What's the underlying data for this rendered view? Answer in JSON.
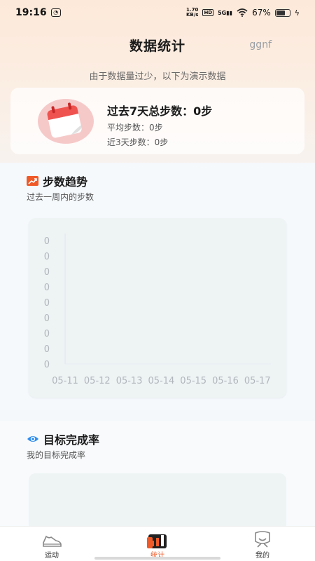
{
  "status_bar": {
    "time": "19:16",
    "net_speed_value": "1.70",
    "net_speed_unit": "KB/s",
    "hd": "HD",
    "signal": "5G",
    "battery": "67%"
  },
  "header": {
    "title": "数据统计",
    "user": "ggnf"
  },
  "notice": "由于数据量过少，以下为演示数据",
  "summary": {
    "total": "过去7天总步数：0步",
    "average": "平均步数：0步",
    "recent3": "近3天步数：0步"
  },
  "trend": {
    "title": "步数趋势",
    "subtitle": "过去一周内的步数"
  },
  "chart_data": {
    "type": "line",
    "x": [
      "05-11",
      "05-12",
      "05-13",
      "05-14",
      "05-15",
      "05-16",
      "05-17"
    ],
    "y_ticks": [
      "0",
      "0",
      "0",
      "0",
      "0",
      "0",
      "0",
      "0",
      "0"
    ],
    "series": [
      {
        "values": [
          0,
          0,
          0,
          0,
          0,
          0,
          0
        ]
      }
    ]
  },
  "goal": {
    "title": "目标完成率",
    "subtitle": "我的目标完成率"
  },
  "tabs": [
    {
      "label": "运动"
    },
    {
      "label": "统计"
    },
    {
      "label": "我的"
    }
  ],
  "colors": {
    "accent": "#f05a28",
    "goal_icon": "#2d8cf0"
  }
}
